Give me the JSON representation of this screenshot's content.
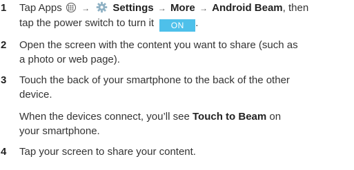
{
  "steps": [
    {
      "number": "1",
      "text_tap": "Tap Apps",
      "icon_apps": "apps-icon",
      "arrow": "→",
      "icon_settings": "gear-icon",
      "settings": "Settings",
      "more": "More",
      "android_beam": "Android Beam",
      "text_then": ", then",
      "text_line2": "tap the power switch to turn it",
      "toggle_label": "ON",
      "text_end": "."
    },
    {
      "number": "2",
      "line1": "Open the screen with the content you want to share (such as",
      "line2": "a photo or web page)."
    },
    {
      "number": "3",
      "line1": "Touch the back of your smartphone to the back of the other",
      "line2": "device.",
      "note_start": "When the devices connect, you’ll see",
      "note_bold": "Touch to Beam",
      "note_after": "on",
      "note_line2": "your smartphone."
    },
    {
      "number": "4",
      "line1": "Tap your screen to share your content."
    }
  ],
  "colors": {
    "toggle_bg": "#4ec0ea",
    "text": "#333333"
  }
}
